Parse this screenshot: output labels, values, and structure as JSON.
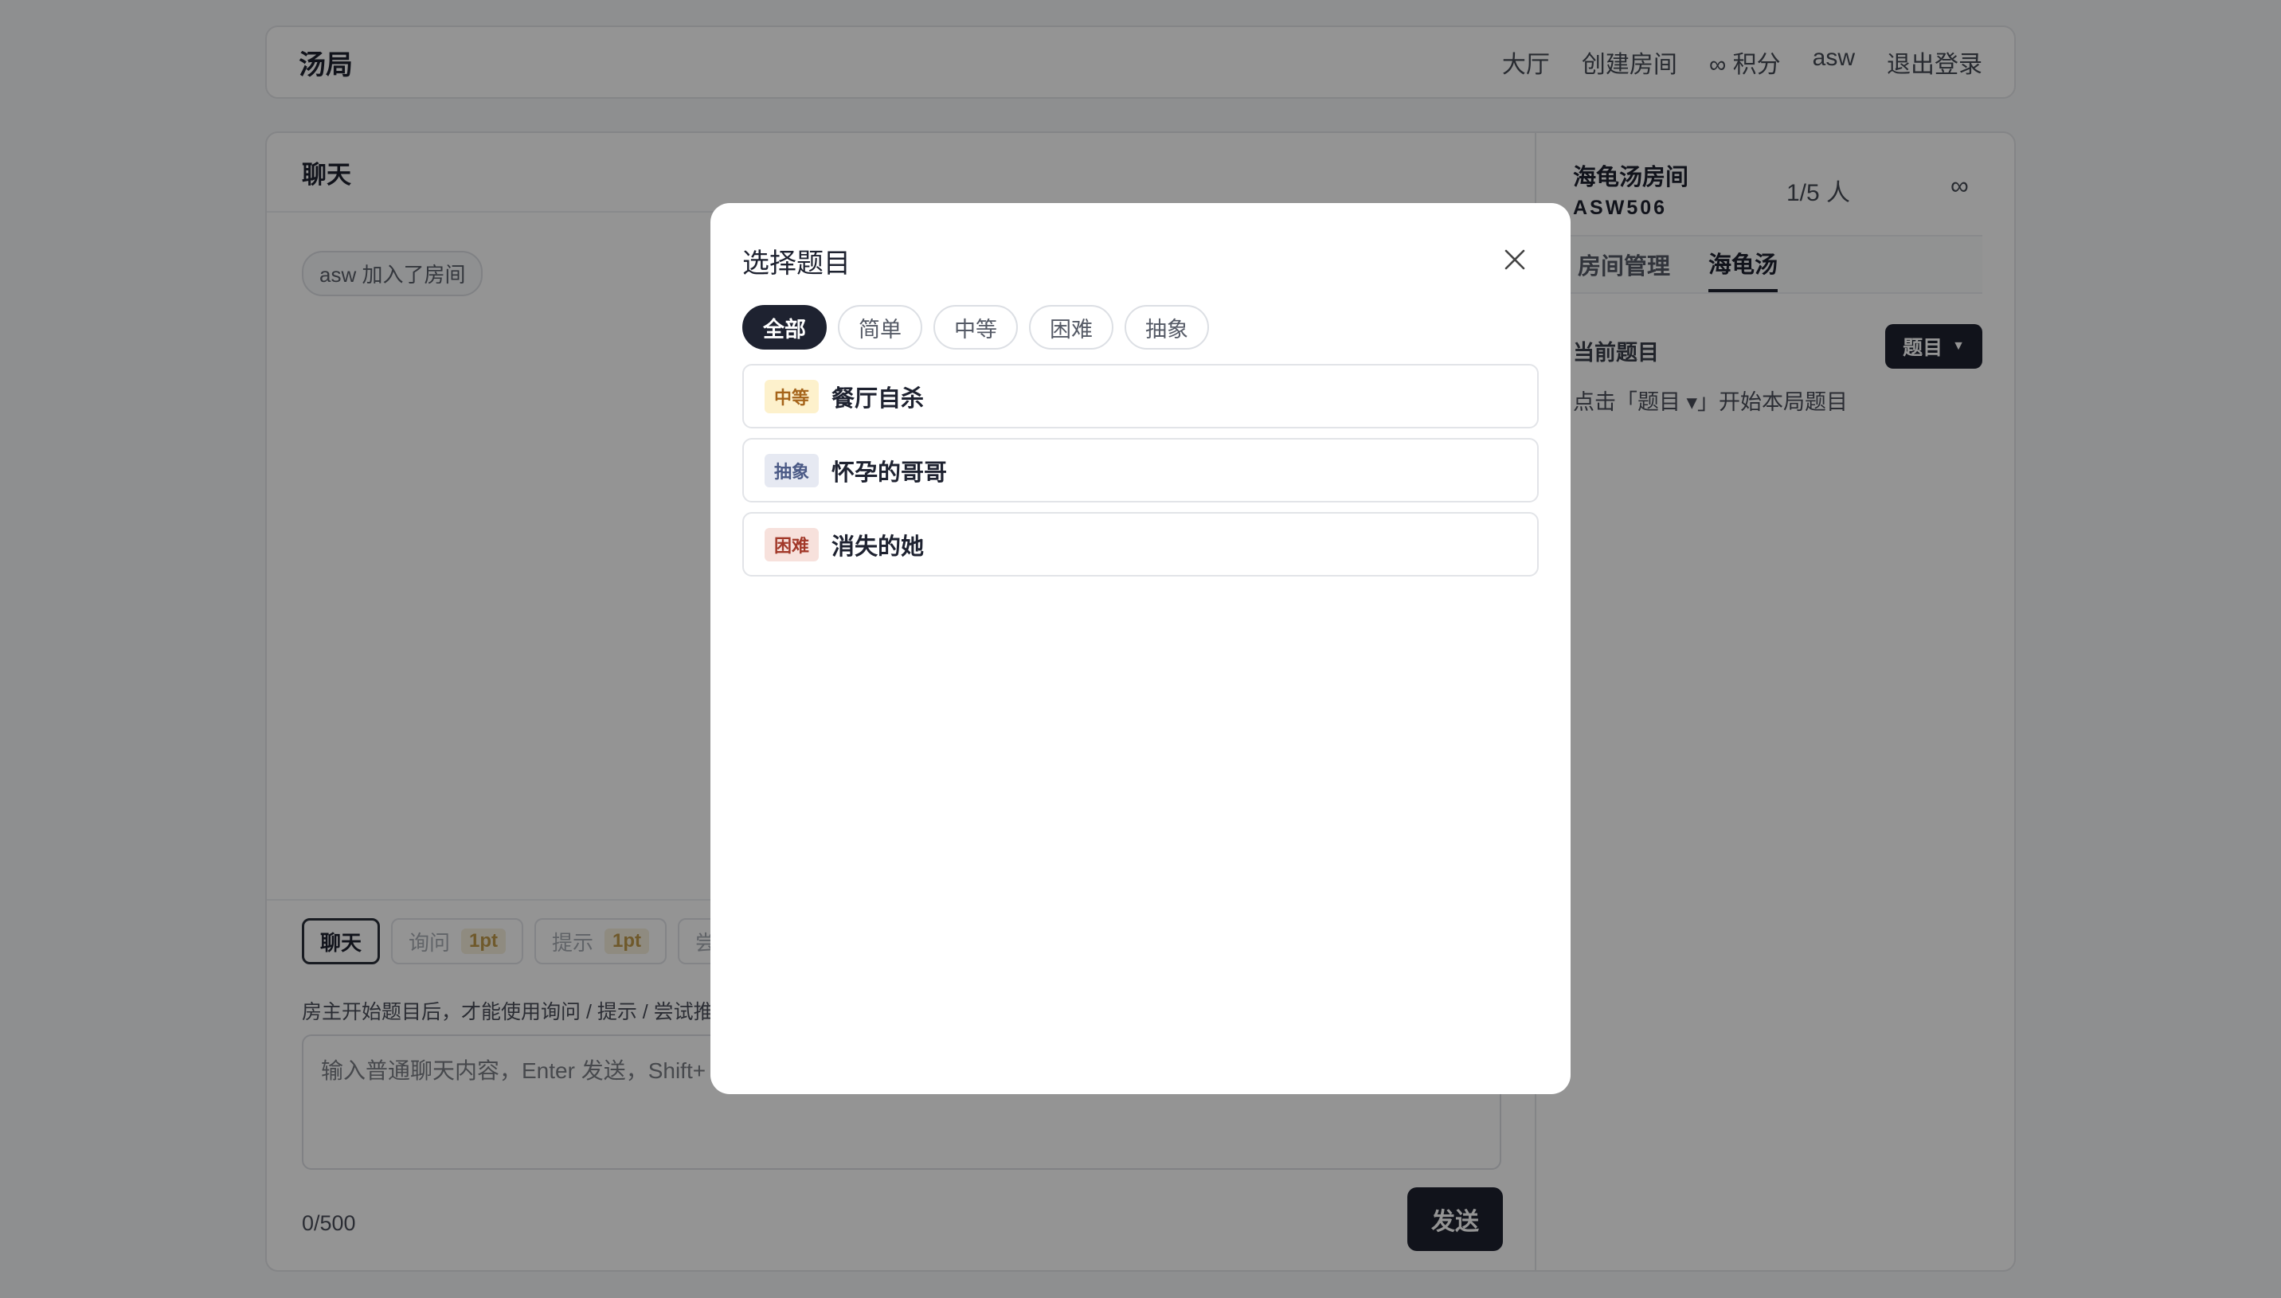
{
  "header": {
    "brand": "汤局",
    "nav": [
      "大厅",
      "创建房间",
      "∞ 积分",
      "asw",
      "退出登录"
    ]
  },
  "chat": {
    "title": "聊天",
    "system_message": "asw 加入了房间",
    "modes": [
      {
        "label": "聊天",
        "cost": ""
      },
      {
        "label": "询问",
        "cost": "1pt"
      },
      {
        "label": "提示",
        "cost": "1pt"
      },
      {
        "label": "尝",
        "cost": ""
      }
    ],
    "hint": "房主开始题目后，才能使用询问 / 提示 / 尝试推",
    "input_placeholder": "输入普通聊天内容，Enter 发送，Shift+",
    "counter": "0/500",
    "send_label": "发送"
  },
  "side": {
    "room_name": "海龟汤房间",
    "room_code": "ASW506",
    "player_count": "1/5 人",
    "infinity": "∞",
    "tabs": [
      "房间管理",
      "海龟汤"
    ],
    "active_tab": 1,
    "current_label": "当前题目",
    "topic_button": "题目",
    "current_hint": "点击「题目 ▾」开始本局题目"
  },
  "modal": {
    "title": "选择题目",
    "filters": [
      "全部",
      "简单",
      "中等",
      "困难",
      "抽象"
    ],
    "active_filter": 0,
    "topics": [
      {
        "level": "中等",
        "title": "餐厅自杀",
        "badge_bg": "#fdf1cc",
        "badge_fg": "#a5641a"
      },
      {
        "level": "抽象",
        "title": "怀孕的哥哥",
        "badge_bg": "#e6e9f2",
        "badge_fg": "#4b5a86"
      },
      {
        "level": "困难",
        "title": "消失的她",
        "badge_bg": "#f7e1dc",
        "badge_fg": "#a2392a"
      }
    ]
  }
}
